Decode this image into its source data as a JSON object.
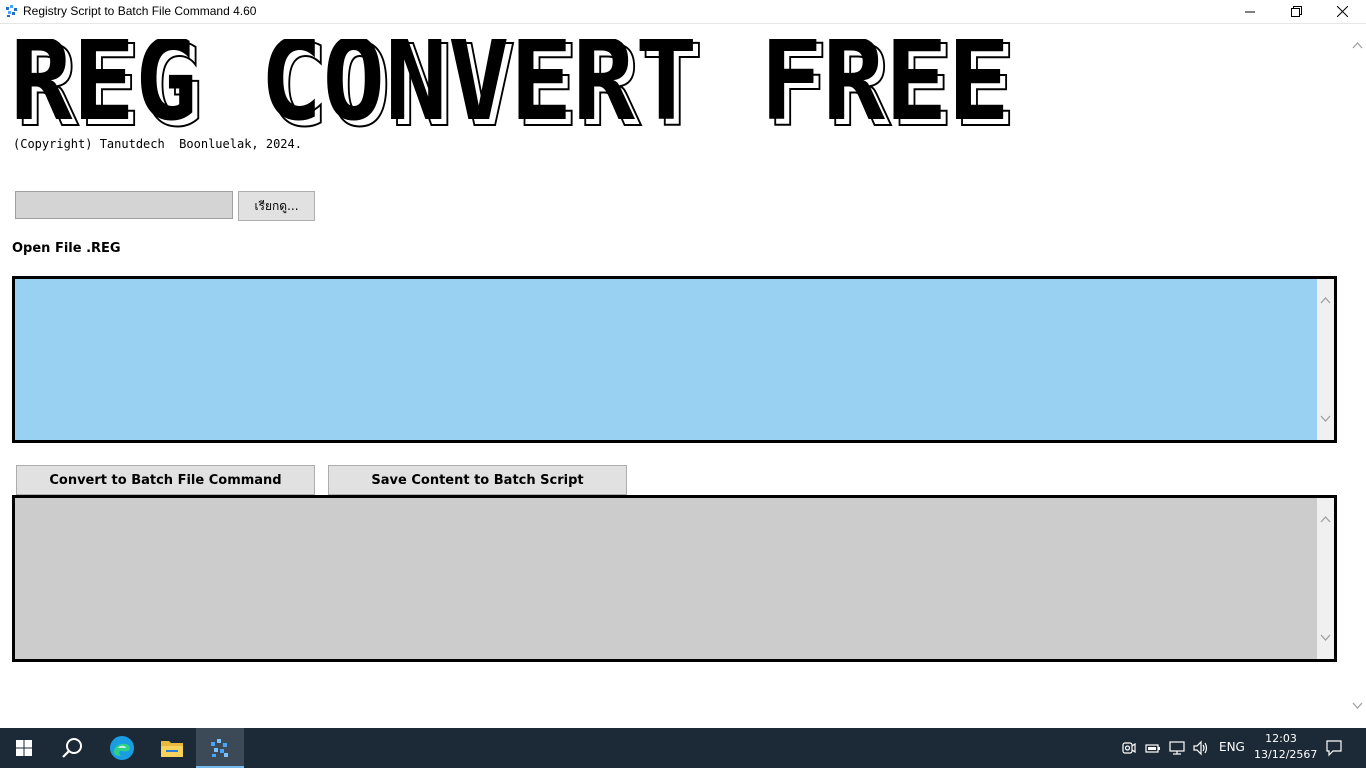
{
  "window": {
    "title": "Registry Script to Batch File Command 4.60",
    "minimize_icon": "minimize-icon",
    "restore_icon": "restore-icon",
    "close_icon": "close-icon"
  },
  "header": {
    "logo_text": "REG CONVERT FREE",
    "copyright": "(Copyright) Tanutdech  Boonluelak, 2024."
  },
  "file_picker": {
    "path_value": "",
    "browse_label": "เรียกดู..."
  },
  "labels": {
    "open_file": "Open File .REG"
  },
  "reg_textarea": {
    "value": "",
    "background": "#99d1f2"
  },
  "batch_textarea": {
    "value": "",
    "background": "#cccccc"
  },
  "buttons": {
    "convert": "Convert to Batch File Command",
    "save": "Save Content to Batch Script"
  },
  "taskbar": {
    "items": [
      "start-icon",
      "search-icon",
      "edge-browser-icon",
      "file-explorer-icon",
      "reg-convert-app-icon"
    ],
    "tray": {
      "language": "ENG",
      "time": "12:03",
      "date": "13/12/2567"
    }
  }
}
